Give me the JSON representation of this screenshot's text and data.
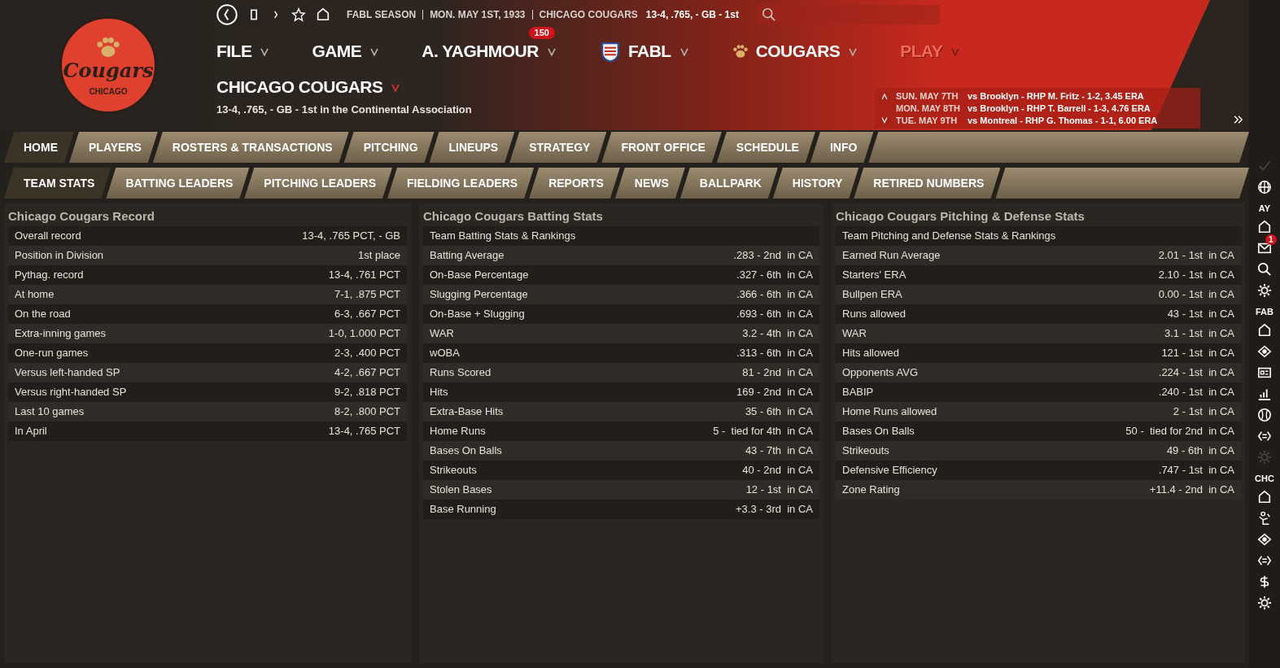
{
  "breadcrumb": [
    "FABL SEASON",
    "MON. MAY 1ST, 1933",
    "CHICAGO COUGARS"
  ],
  "breadcrumb_record": "13-4, .765, - GB - 1st",
  "logo": {
    "name": "Cougars",
    "city": "CHICAGO"
  },
  "menus": [
    {
      "label": "FILE",
      "kind": "plain",
      "disabled": false
    },
    {
      "label": "GAME",
      "kind": "plain",
      "disabled": false
    },
    {
      "label": "A. YAGHMOUR",
      "kind": "plain",
      "badge": "150",
      "disabled": false
    },
    {
      "label": "FABL",
      "kind": "shield",
      "disabled": false
    },
    {
      "label": "COUGARS",
      "kind": "paw",
      "disabled": false
    },
    {
      "label": "PLAY",
      "kind": "plain",
      "disabled": true
    }
  ],
  "team": {
    "name": "CHICAGO COUGARS",
    "summary": "13-4, .765, - GB - 1st in the Continental Association"
  },
  "schedule": [
    {
      "date": "SUN. MAY 7TH",
      "matchup": "vs Brooklyn - RHP M. Fritz - 1-2, 3.45 ERA"
    },
    {
      "date": "MON. MAY 8TH",
      "matchup": "vs Brooklyn - RHP T. Barrell - 1-3, 4.76 ERA"
    },
    {
      "date": "TUE. MAY 9TH",
      "matchup": "vs Montreal - RHP G. Thomas - 1-1, 6.00 ERA"
    }
  ],
  "tabs": [
    {
      "label": "HOME",
      "selected": true
    },
    {
      "label": "PLAYERS",
      "selected": false
    },
    {
      "label": "ROSTERS & TRANSACTIONS",
      "selected": false
    },
    {
      "label": "PITCHING",
      "selected": false
    },
    {
      "label": "LINEUPS",
      "selected": false
    },
    {
      "label": "STRATEGY",
      "selected": false
    },
    {
      "label": "FRONT OFFICE",
      "selected": false
    },
    {
      "label": "SCHEDULE",
      "selected": false
    },
    {
      "label": "INFO",
      "selected": false
    }
  ],
  "subtabs": [
    {
      "label": "TEAM STATS",
      "selected": true
    },
    {
      "label": "BATTING LEADERS",
      "selected": false
    },
    {
      "label": "PITCHING LEADERS",
      "selected": false
    },
    {
      "label": "FIELDING LEADERS",
      "selected": false
    },
    {
      "label": "REPORTS",
      "selected": false
    },
    {
      "label": "NEWS",
      "selected": false
    },
    {
      "label": "BALLPARK",
      "selected": false
    },
    {
      "label": "HISTORY",
      "selected": false
    },
    {
      "label": "RETIRED NUMBERS",
      "selected": false
    }
  ],
  "panels": [
    {
      "title": "Chicago Cougars Record",
      "rows": [
        {
          "label": "Overall record",
          "value": "13-4, .765 PCT, - GB"
        },
        {
          "label": "Position in Division",
          "value": "1st place"
        },
        {
          "label": "Pythag. record",
          "value": "13-4, .761 PCT"
        },
        {
          "label": "At home",
          "value": "7-1, .875 PCT"
        },
        {
          "label": "On the road",
          "value": "6-3, .667 PCT"
        },
        {
          "label": "Extra-inning games",
          "value": "1-0, 1.000 PCT"
        },
        {
          "label": "One-run games",
          "value": "2-3, .400 PCT"
        },
        {
          "label": "Versus left-handed SP",
          "value": "4-2, .667 PCT"
        },
        {
          "label": "Versus right-handed SP",
          "value": "9-2, .818 PCT"
        },
        {
          "label": "Last 10 games",
          "value": "8-2, .800 PCT"
        },
        {
          "label": "In April",
          "value": "13-4, .765 PCT"
        }
      ]
    },
    {
      "title": "Chicago Cougars Batting Stats",
      "rows": [
        {
          "label": "Team Batting Stats & Rankings"
        },
        {
          "label": "Batting Average",
          "value": ".283 - 2nd  in CA"
        },
        {
          "label": "On-Base Percentage",
          "value": ".327 - 6th  in CA"
        },
        {
          "label": "Slugging Percentage",
          "value": ".366 - 6th  in CA"
        },
        {
          "label": "On-Base + Slugging",
          "value": ".693 - 6th  in CA"
        },
        {
          "label": "WAR",
          "value": "3.2 - 4th  in CA"
        },
        {
          "label": "wOBA",
          "value": ".313 - 6th  in CA"
        },
        {
          "label": "Runs Scored",
          "value": "81 - 2nd  in CA"
        },
        {
          "label": "Hits",
          "value": "169 - 2nd  in CA"
        },
        {
          "label": "Extra-Base Hits",
          "value": "35 - 6th  in CA"
        },
        {
          "label": "Home Runs",
          "value": "5 -  tied for 4th  in CA"
        },
        {
          "label": "Bases On Balls",
          "value": "43 - 7th  in CA"
        },
        {
          "label": "Strikeouts",
          "value": "40 - 2nd  in CA"
        },
        {
          "label": "Stolen Bases",
          "value": "12 - 1st  in CA"
        },
        {
          "label": "Base Running",
          "value": "+3.3 - 3rd  in CA"
        }
      ]
    },
    {
      "title": "Chicago Cougars Pitching & Defense Stats",
      "rows": [
        {
          "label": "Team Pitching and Defense Stats & Rankings"
        },
        {
          "label": "Earned Run Average",
          "value": "2.01 - 1st  in CA"
        },
        {
          "label": "Starters' ERA",
          "value": "2.10 - 1st  in CA"
        },
        {
          "label": "Bullpen ERA",
          "value": "0.00 - 1st  in CA"
        },
        {
          "label": "Runs allowed",
          "value": "43 - 1st  in CA"
        },
        {
          "label": "WAR",
          "value": "3.1 - 1st  in CA"
        },
        {
          "label": "Hits allowed",
          "value": "121 - 1st  in CA"
        },
        {
          "label": "Opponents AVG",
          "value": ".224 - 1st  in CA"
        },
        {
          "label": "BABIP",
          "value": ".240 - 1st  in CA"
        },
        {
          "label": "Home Runs allowed",
          "value": "2 - 1st  in CA"
        },
        {
          "label": "Bases On Balls",
          "value": "50 -  tied for 2nd  in CA"
        },
        {
          "label": "Strikeouts",
          "value": "49 - 6th  in CA"
        },
        {
          "label": "Defensive Efficiency",
          "value": ".747 - 1st  in CA"
        },
        {
          "label": "Zone Rating",
          "value": "+11.4 - 2nd  in CA"
        }
      ]
    }
  ],
  "sidebar": [
    {
      "label": "AY",
      "badge": "1"
    },
    {
      "label": "FAB"
    },
    {
      "label": "CHC"
    }
  ]
}
